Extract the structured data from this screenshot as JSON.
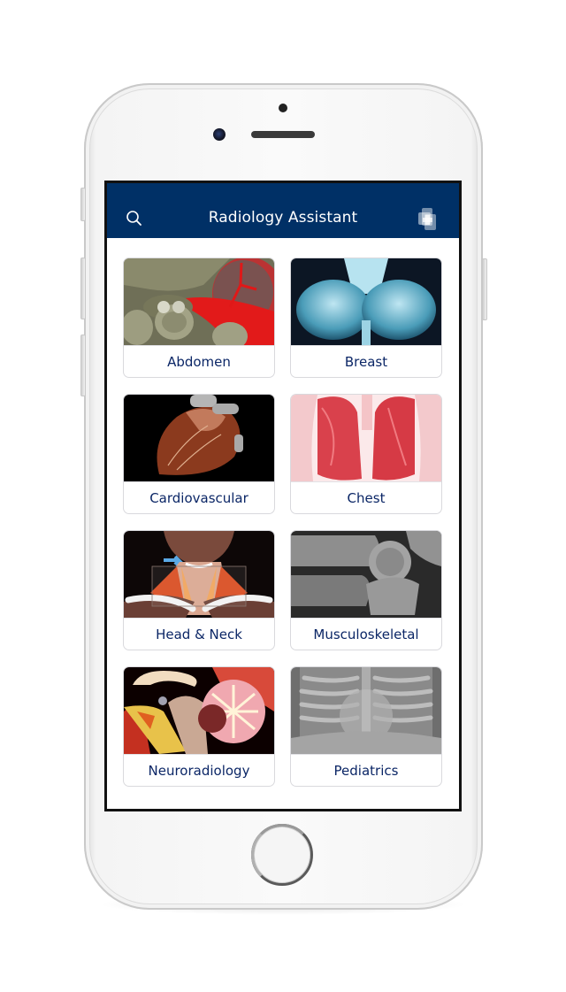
{
  "app": {
    "title": "Radiology Assistant",
    "colors": {
      "navbar": "#003066",
      "label_text": "#0b2666",
      "tile_border": "#d9d9dd"
    }
  },
  "navbar": {
    "title": "Radiology Assistant",
    "left_icon": "search-icon",
    "right_icon": "app-logo-icon"
  },
  "categories": [
    {
      "label": "Abdomen",
      "image": "abdomen-ct-illustration"
    },
    {
      "label": "Breast",
      "image": "mammogram"
    },
    {
      "label": "Cardiovascular",
      "image": "heart-3d-ct"
    },
    {
      "label": "Chest",
      "image": "lungs-3d-render"
    },
    {
      "label": "Head & Neck",
      "image": "neck-anatomy-illustration"
    },
    {
      "label": "Musculoskeletal",
      "image": "elbow-xray"
    },
    {
      "label": "Neuroradiology",
      "image": "brain-sagittal-illustration"
    },
    {
      "label": "Pediatrics",
      "image": "pediatric-chest-xray"
    }
  ],
  "device": {
    "home_button": "home-button"
  }
}
